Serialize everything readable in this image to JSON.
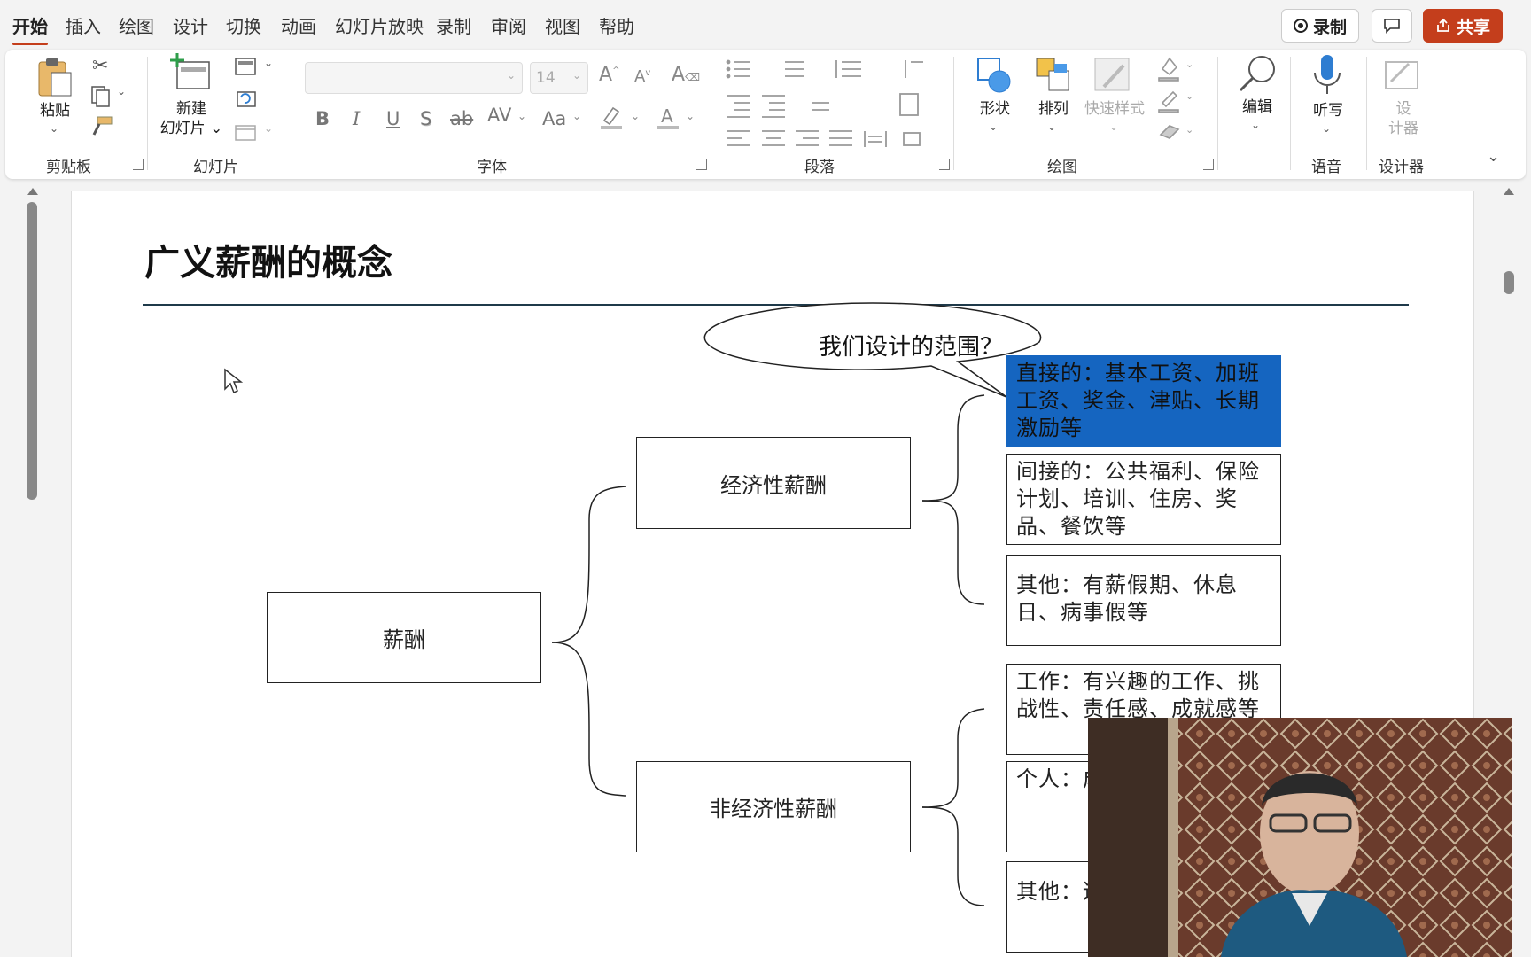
{
  "menu": {
    "tabs": [
      "开始",
      "插入",
      "绘图",
      "设计",
      "切换",
      "动画",
      "幻灯片放映",
      "录制",
      "审阅",
      "视图",
      "帮助"
    ],
    "active_tab": "开始",
    "record_label": "录制",
    "share_label": "共享"
  },
  "ribbon": {
    "clipboard": {
      "paste_label": "粘贴",
      "group_label": "剪贴板"
    },
    "slides": {
      "new_slide_line1": "新建",
      "new_slide_line2": "幻灯片",
      "group_label": "幻灯片"
    },
    "font": {
      "font_name": "",
      "font_size": "14",
      "group_label": "字体",
      "bold": "B",
      "italic": "I",
      "underline": "U",
      "shadow": "S",
      "strike": "ab",
      "spacing": "AV",
      "case": "Aa"
    },
    "paragraph": {
      "group_label": "段落"
    },
    "drawing": {
      "shapes_label": "形状",
      "arrange_label": "排列",
      "quick_styles_label": "快速样式",
      "group_label": "绘图"
    },
    "editing": {
      "label": "编辑"
    },
    "voice": {
      "dictate_label": "听写",
      "group_label": "语音"
    },
    "designer": {
      "label_line1": "设",
      "label_line2": "计器",
      "group_label": "设计器"
    }
  },
  "slide": {
    "title": "广义薪酬的概念",
    "callout": "我们设计的范围？",
    "root": "薪酬",
    "branch_economic": "经济性薪酬",
    "branch_noneconomic": "非经济性薪酬",
    "leaves": [
      "直接的：基本工资、加班工资、奖金、津贴、长期激励等",
      "间接的：公共福利、保险计划、培训、住房、奖品、餐饮等",
      "其他：有薪假期、休息日、病事假等",
      "工作：有兴趣的工作、挑战性、责任感、成就感等",
      "个人：成长、等",
      "其他：适的工"
    ]
  },
  "colors": {
    "accent": "#c43e1c",
    "selection": "#1565c0"
  }
}
